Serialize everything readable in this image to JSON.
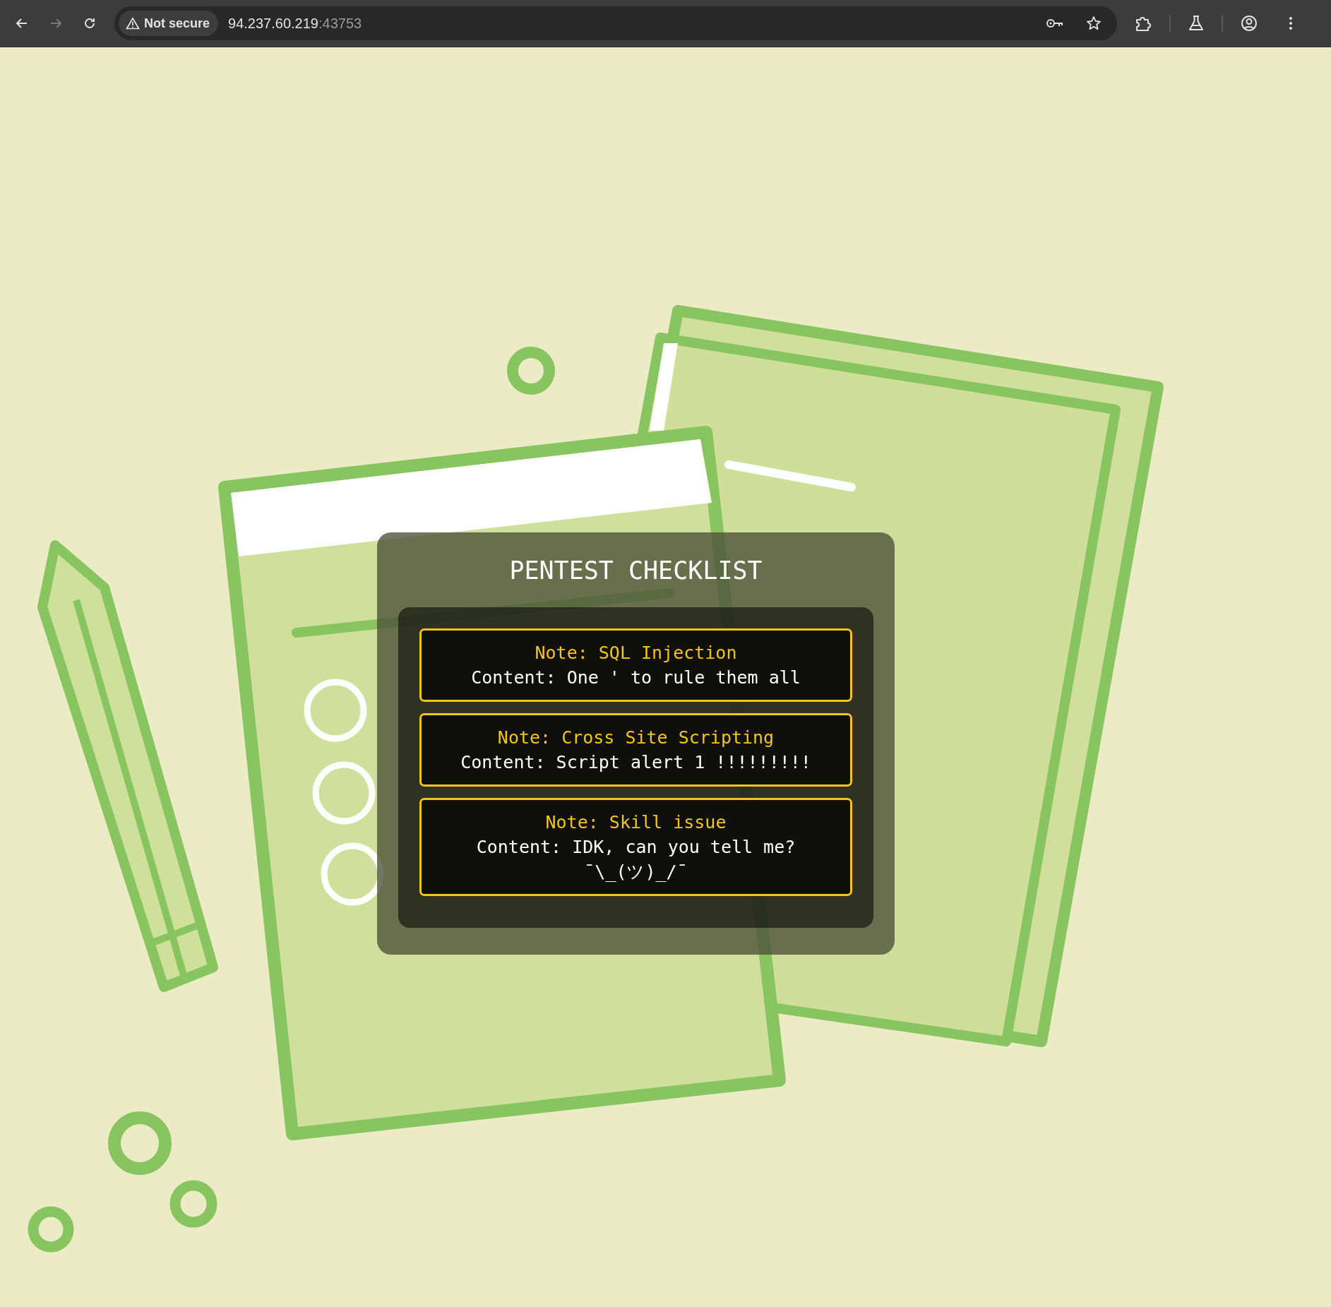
{
  "browser": {
    "forward_disabled": true,
    "security_chip": "Not secure",
    "url_host": "94.237.60.219",
    "url_port": ":43753"
  },
  "page": {
    "title": "PENTEST CHECKLIST",
    "notes": [
      {
        "title": "Note: SQL Injection",
        "content": "Content: One ' to rule them all"
      },
      {
        "title": "Note: Cross Site Scripting",
        "content": "Content: Script alert 1 !!!!!!!!!"
      },
      {
        "title": "Note: Skill issue",
        "content": "Content: IDK, can you tell me? ¯\\_(ツ)_/¯"
      }
    ]
  }
}
